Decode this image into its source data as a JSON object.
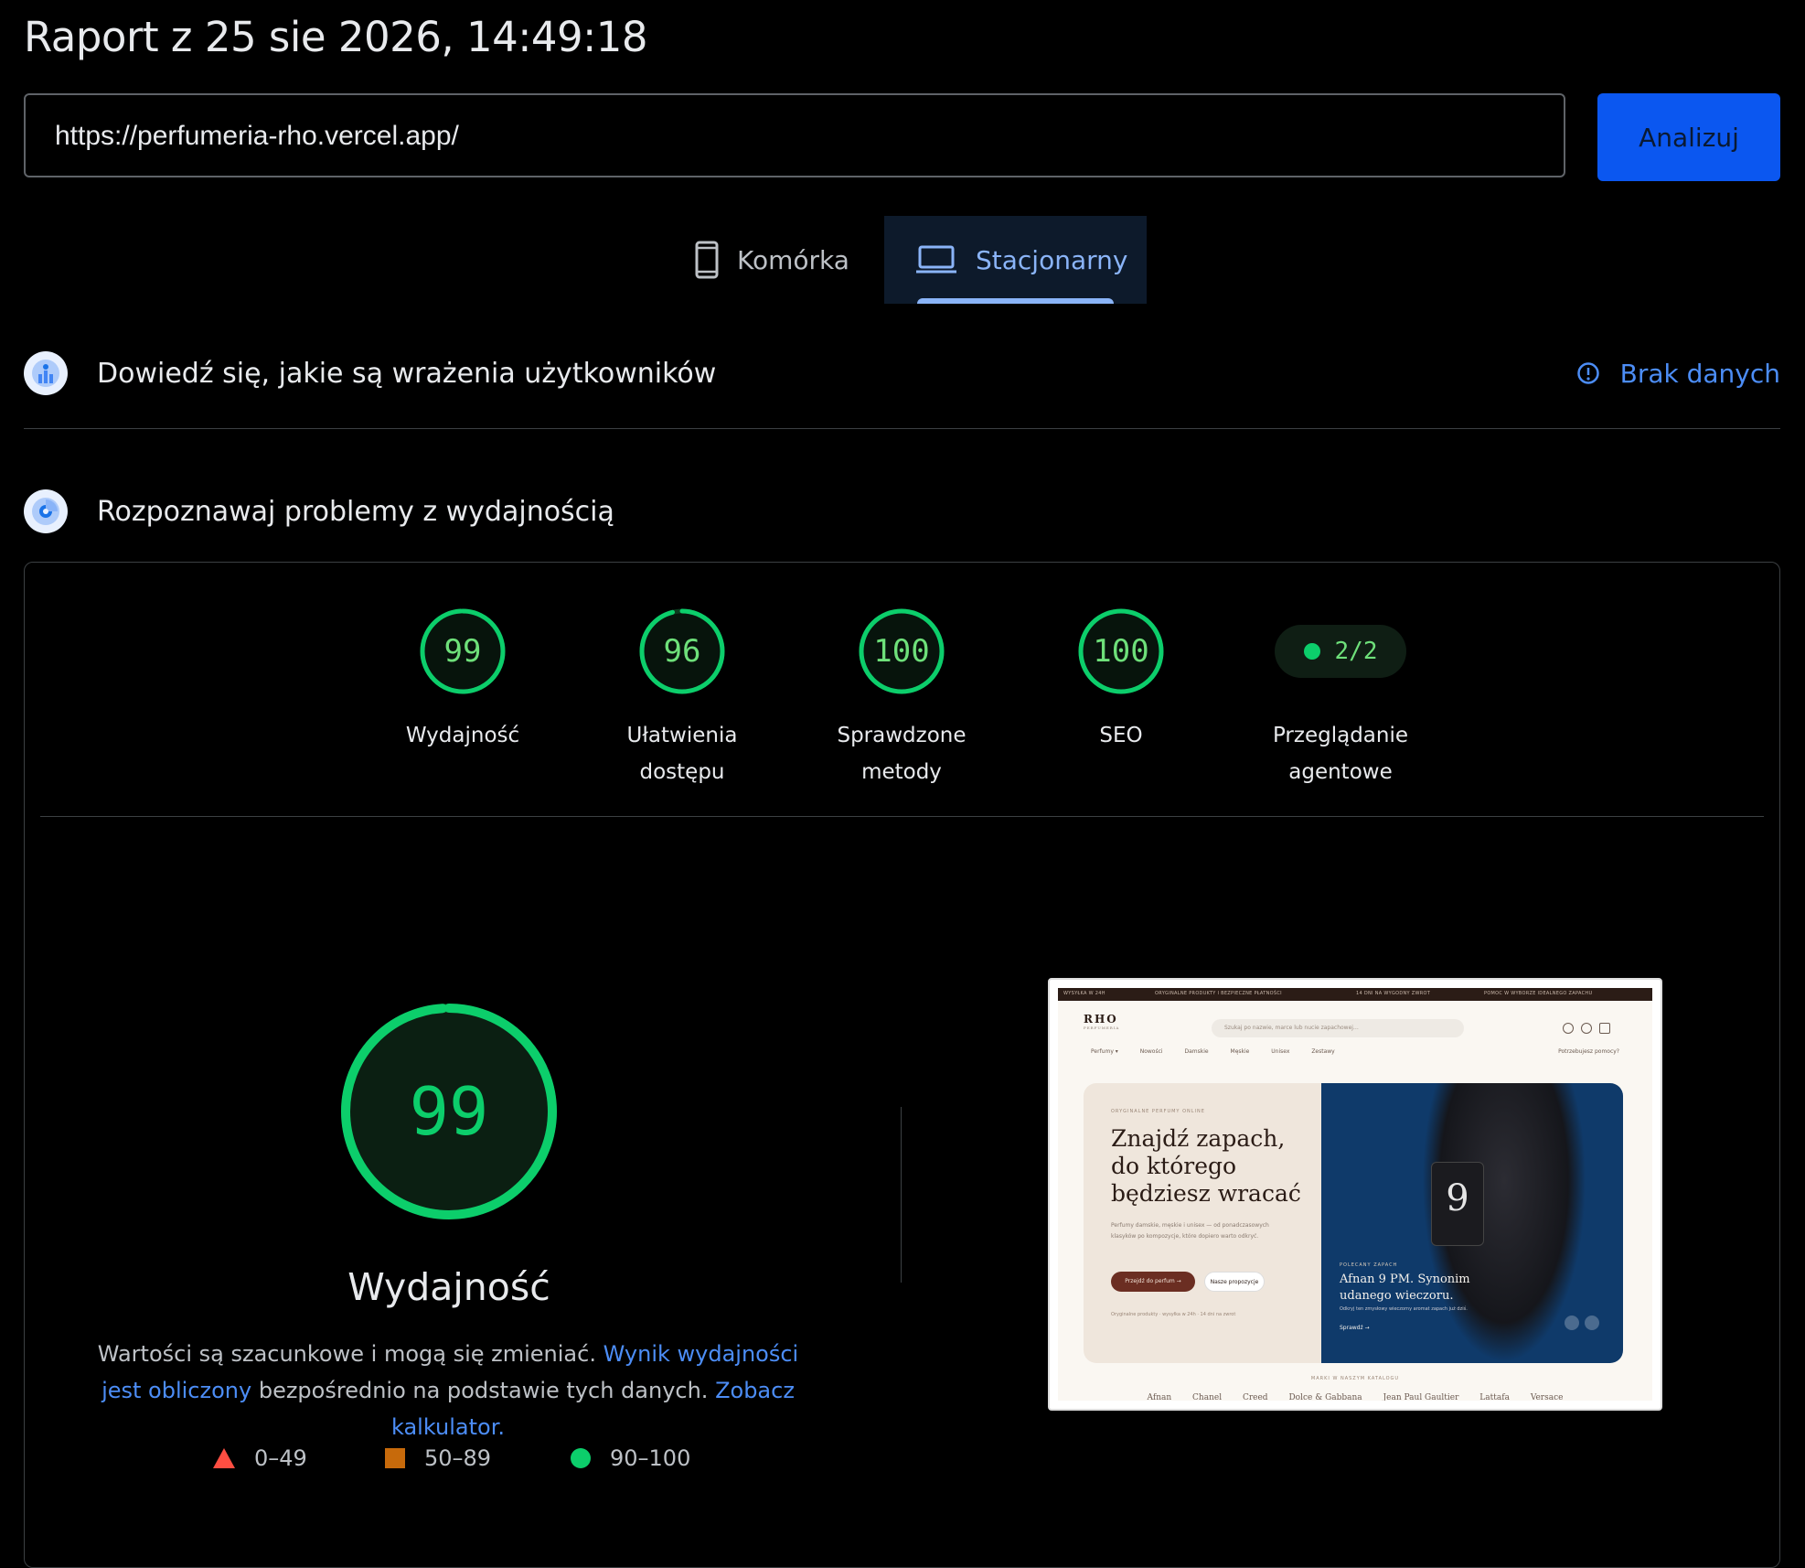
{
  "report_title": "Raport z 25 sie 2026, 14:49:18",
  "url_input": {
    "value": "https://perfumeria-rho.vercel.app/"
  },
  "analyze_button": "Analizuj",
  "tabs": [
    {
      "label": "Komórka",
      "icon": "smartphone-icon",
      "selected": false
    },
    {
      "label": "Stacjonarny",
      "icon": "laptop-icon",
      "selected": true
    }
  ],
  "field_data": {
    "title": "Dowiedź się, jakie są wrażenia użytkowników",
    "status": "Brak danych",
    "icon": "users-chart-icon"
  },
  "lab_data": {
    "title": "Rozpoznawaj problemy z wydajnością",
    "icon": "lighthouse-icon"
  },
  "categories": [
    {
      "score": "99",
      "value": 99,
      "label_line1": "Wydajność",
      "label_line2": ""
    },
    {
      "score": "96",
      "value": 96,
      "label_line1": "Ułatwienia",
      "label_line2": "dostępu"
    },
    {
      "score": "100",
      "value": 100,
      "label_line1": "Sprawdzone",
      "label_line2": "metody"
    },
    {
      "score": "100",
      "value": 100,
      "label_line1": "SEO",
      "label_line2": ""
    }
  ],
  "agentic": {
    "value": "2/2",
    "label_line1": "Przeglądanie",
    "label_line2": "agentowe"
  },
  "performance": {
    "score": "99",
    "value": 99,
    "label": "Wydajność",
    "desc_text1": "Wartości są szacunkowe i mogą się zmieniać. ",
    "desc_link1": "Wynik wydajności jest obliczony",
    "desc_text2": " bezpośrednio na podstawie tych danych. ",
    "desc_link2": "Zobacz kalkulator."
  },
  "legend": [
    {
      "range": "0–49",
      "shape": "triangle",
      "color": "#ff4e42"
    },
    {
      "range": "50–89",
      "shape": "square",
      "color": "#c76a0b"
    },
    {
      "range": "90–100",
      "shape": "circle",
      "color": "#0cce6b"
    }
  ],
  "colors": {
    "pass": "#0cce6b",
    "accent": "#0b57f0",
    "link": "#4c8df6"
  },
  "screenshot": {
    "topbar": [
      "WYSYŁKA W 24H",
      "ORYGINALNE PRODUKTY I BEZPIECZNE PŁATNOŚCI",
      "14 DNI NA WYGODNY ZWROT",
      "POMOC W WYBORZE IDEALNEGO ZAPACHU"
    ],
    "logo": "RHO",
    "logo_sub": "PERFUMERIA",
    "search_placeholder": "Szukaj po nazwie, marce lub nucie zapachowej…",
    "nav": [
      "Perfumy ▾",
      "Nowości",
      "Damskie",
      "Męskie",
      "Unisex",
      "Zestawy"
    ],
    "nav_right": "Potrzebujesz pomocy?",
    "eyebrow": "ORYGINALNE PERFUMY ONLINE",
    "headline": "Znajdź zapach, do którego będziesz wracać",
    "sub": "Perfumy damskie, męskie i unisex — od ponadczasowych klasyków po kompozycje, które dopiero warto odkryć.",
    "btn_primary": "Przejdź do perfum →",
    "btn_secondary": "Nasze propozycje",
    "note": "Oryginalne produkty · wysyłka w 24h · 14 dni na zwrot",
    "bottle_number": "9",
    "slide_eyebrow": "POLECANY ZAPACH",
    "slide_title": "Afnan 9 PM. Synonim udanego wieczoru.",
    "slide_sub": "Odkryj ten zmysłowy wieczorny aromat zapach już dziś.",
    "slide_link": "Sprawdź →",
    "brands_title": "MARKI W NASZYM KATALOGU",
    "brands": [
      "Afnan",
      "Chanel",
      "Creed",
      "Dolce & Gabbana",
      "Jean Paul Gaultier",
      "Lattafa",
      "Versace"
    ]
  }
}
